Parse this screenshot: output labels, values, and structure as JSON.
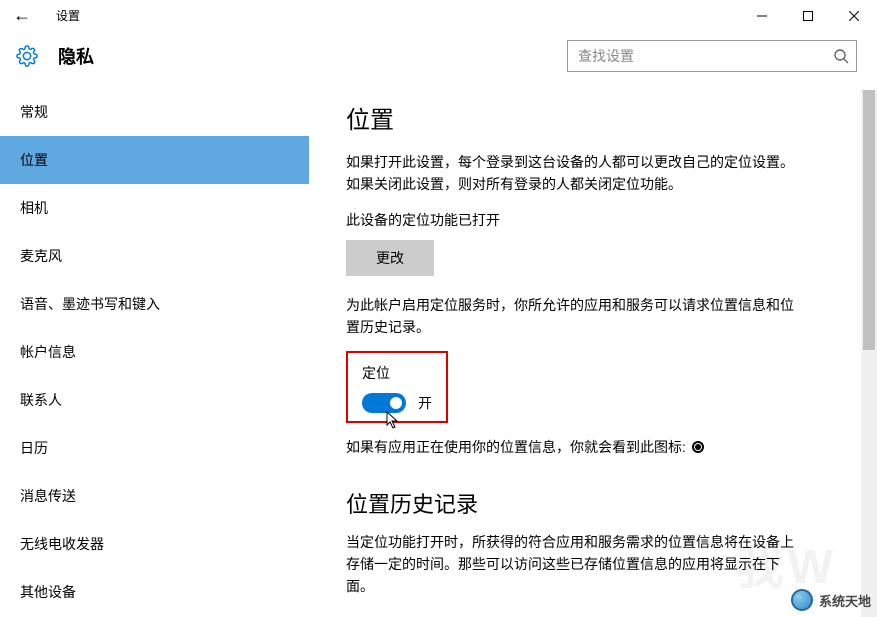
{
  "titlebar": {
    "back": "←",
    "title": "设置"
  },
  "header": {
    "title": "隐私",
    "search_placeholder": "查找设置"
  },
  "sidebar": {
    "items": [
      {
        "label": "常规",
        "active": false
      },
      {
        "label": "位置",
        "active": true
      },
      {
        "label": "相机",
        "active": false
      },
      {
        "label": "麦克风",
        "active": false
      },
      {
        "label": "语音、墨迹书写和键入",
        "active": false
      },
      {
        "label": "帐户信息",
        "active": false
      },
      {
        "label": "联系人",
        "active": false
      },
      {
        "label": "日历",
        "active": false
      },
      {
        "label": "消息传送",
        "active": false
      },
      {
        "label": "无线电收发器",
        "active": false
      },
      {
        "label": "其他设备",
        "active": false
      }
    ]
  },
  "content": {
    "section1_title": "位置",
    "para1": "如果打开此设置，每个登录到这台设备的人都可以更改自己的定位设置。如果关闭此设置，则对所有登录的人都关闭定位功能。",
    "status": "此设备的定位功能已打开",
    "change_btn": "更改",
    "para2": "为此帐户启用定位服务时，你所允许的应用和服务可以请求位置信息和位置历史记录。",
    "toggle_label": "定位",
    "toggle_state": "开",
    "indicator_text": "如果有应用正在使用你的位置信息，你就会看到此图标:",
    "section2_title": "位置历史记录",
    "para3": "当定位功能打开时，所获得的符合应用和服务需求的位置信息将在设备上存储一定的时间。那些可以访问这些已存储位置信息的应用将显示在下面。"
  },
  "watermark": {
    "text": "系统天地",
    "bg": "我W"
  }
}
